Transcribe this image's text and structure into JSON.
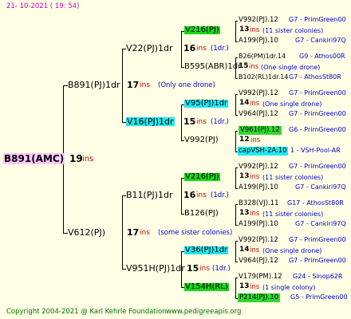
{
  "header": {
    "date": "21- 10-2021 ( 19: 54)"
  },
  "root": {
    "name": "B891(AMC)",
    "ins": "19",
    "ins_label": "ins"
  },
  "gen1": [
    {
      "name": "B891(PJ)1dr",
      "ins": "17",
      "ins_label": "ins",
      "note": "(Only one drone)"
    },
    {
      "name": "V612(PJ)",
      "ins": "17",
      "ins_label": "ins",
      "note": "(some sister colonies)"
    }
  ],
  "gen2": [
    {
      "name": "V22(PJ)1dr",
      "ins": "16",
      "ins_label": "ins",
      "note": "(1dr.)"
    },
    {
      "name": "V16(PJ)1dr",
      "ins": "15",
      "ins_label": "ins",
      "note": "(1dr.)"
    },
    {
      "name": "B11(PJ)1dr",
      "ins": "16",
      "ins_label": "ins",
      "note": "(1dr.)"
    },
    {
      "name": "V951H(PJ)1dr",
      "ins": "15",
      "ins_label": "ins",
      "note": "(1dr.)"
    }
  ],
  "gen3": [
    {
      "name": "V216(PJ)"
    },
    {
      "name": "B595(ABR)1dr"
    },
    {
      "name": "V95(PJ)1dr"
    },
    {
      "name": "V992(PJ)"
    },
    {
      "name": "V216(PJ)"
    },
    {
      "name": "B126(PJ)"
    },
    {
      "name": "V36(PJ)1dr"
    },
    {
      "name": "V154H(RL)"
    }
  ],
  "gen4": [
    {
      "p1": "V992(PJ).12",
      "p1code": "G7 - PrimGreen00",
      "ins": "13",
      "ins_label": "ins",
      "note": "(11 sister colonies)",
      "p2": "A199(PJ).10",
      "p2code": "G7 - Cankiri97Q"
    },
    {
      "p1": "B26(PM)1dr.14",
      "p1code": "G9 - Athos00R",
      "ins": "15",
      "ins_label": "ins",
      "note": "(One single drone)",
      "p2": "B102(RL)1dr.14",
      "p2code": "G7 - AthosSt80R"
    },
    {
      "p1": "V992(PJ).12",
      "p1code": "G7 - PrimGreen00",
      "ins": "14",
      "ins_label": "ins",
      "note": "(One single drone)",
      "p2": "V964(PJ).12",
      "p2code": "G7 - PrimGreen00"
    },
    {
      "p1": "V961(PJ).12",
      "p1code": "G6 - PrimGreen00",
      "ins": "12",
      "ins_label": "ins",
      "note": "",
      "p2": "capVSH-2A.10",
      "p2code": "1 - VSH-Pool-AR"
    },
    {
      "p1": "V992(PJ).12",
      "p1code": "G7 - PrimGreen00",
      "ins": "13",
      "ins_label": "ins",
      "note": "(11 sister colonies)",
      "p2": "A199(PJ).10",
      "p2code": "G7 - Cankiri97Q"
    },
    {
      "p1": "B328(VJ).11",
      "p1code": "G17 - AthosSt80R",
      "ins": "13",
      "ins_label": "ins",
      "note": "(11 sister colonies)",
      "p2": "A199(PJ).10",
      "p2code": "G7 - Cankiri97Q"
    },
    {
      "p1": "V992(PJ).12",
      "p1code": "G7 - PrimGreen00",
      "ins": "14",
      "ins_label": "ins",
      "note": "(One single drone)",
      "p2": "V964(PJ).12",
      "p2code": "G7 - PrimGreen00"
    },
    {
      "p1": "V179(PM).12",
      "p1code": "G24 - Sinop62R",
      "ins": "13",
      "ins_label": "ins",
      "note": "(1 single colony)",
      "p2": "P214(PJ).10",
      "p2code": "G5 - PrimGreen00"
    }
  ],
  "footer": {
    "copyright": "Copyright 2004-2021 @ Karl Kehrle Foundation",
    "url": "www.pedigreeapis.org"
  },
  "colors": {
    "background": "#ffffe6",
    "highlight_green": "#18d818",
    "highlight_cyan": "#20e8f0",
    "highlight_pink": "#ffc8ff",
    "ins_red": "#d00000",
    "code_blue": "#0000cc",
    "footer_green": "#007000"
  }
}
